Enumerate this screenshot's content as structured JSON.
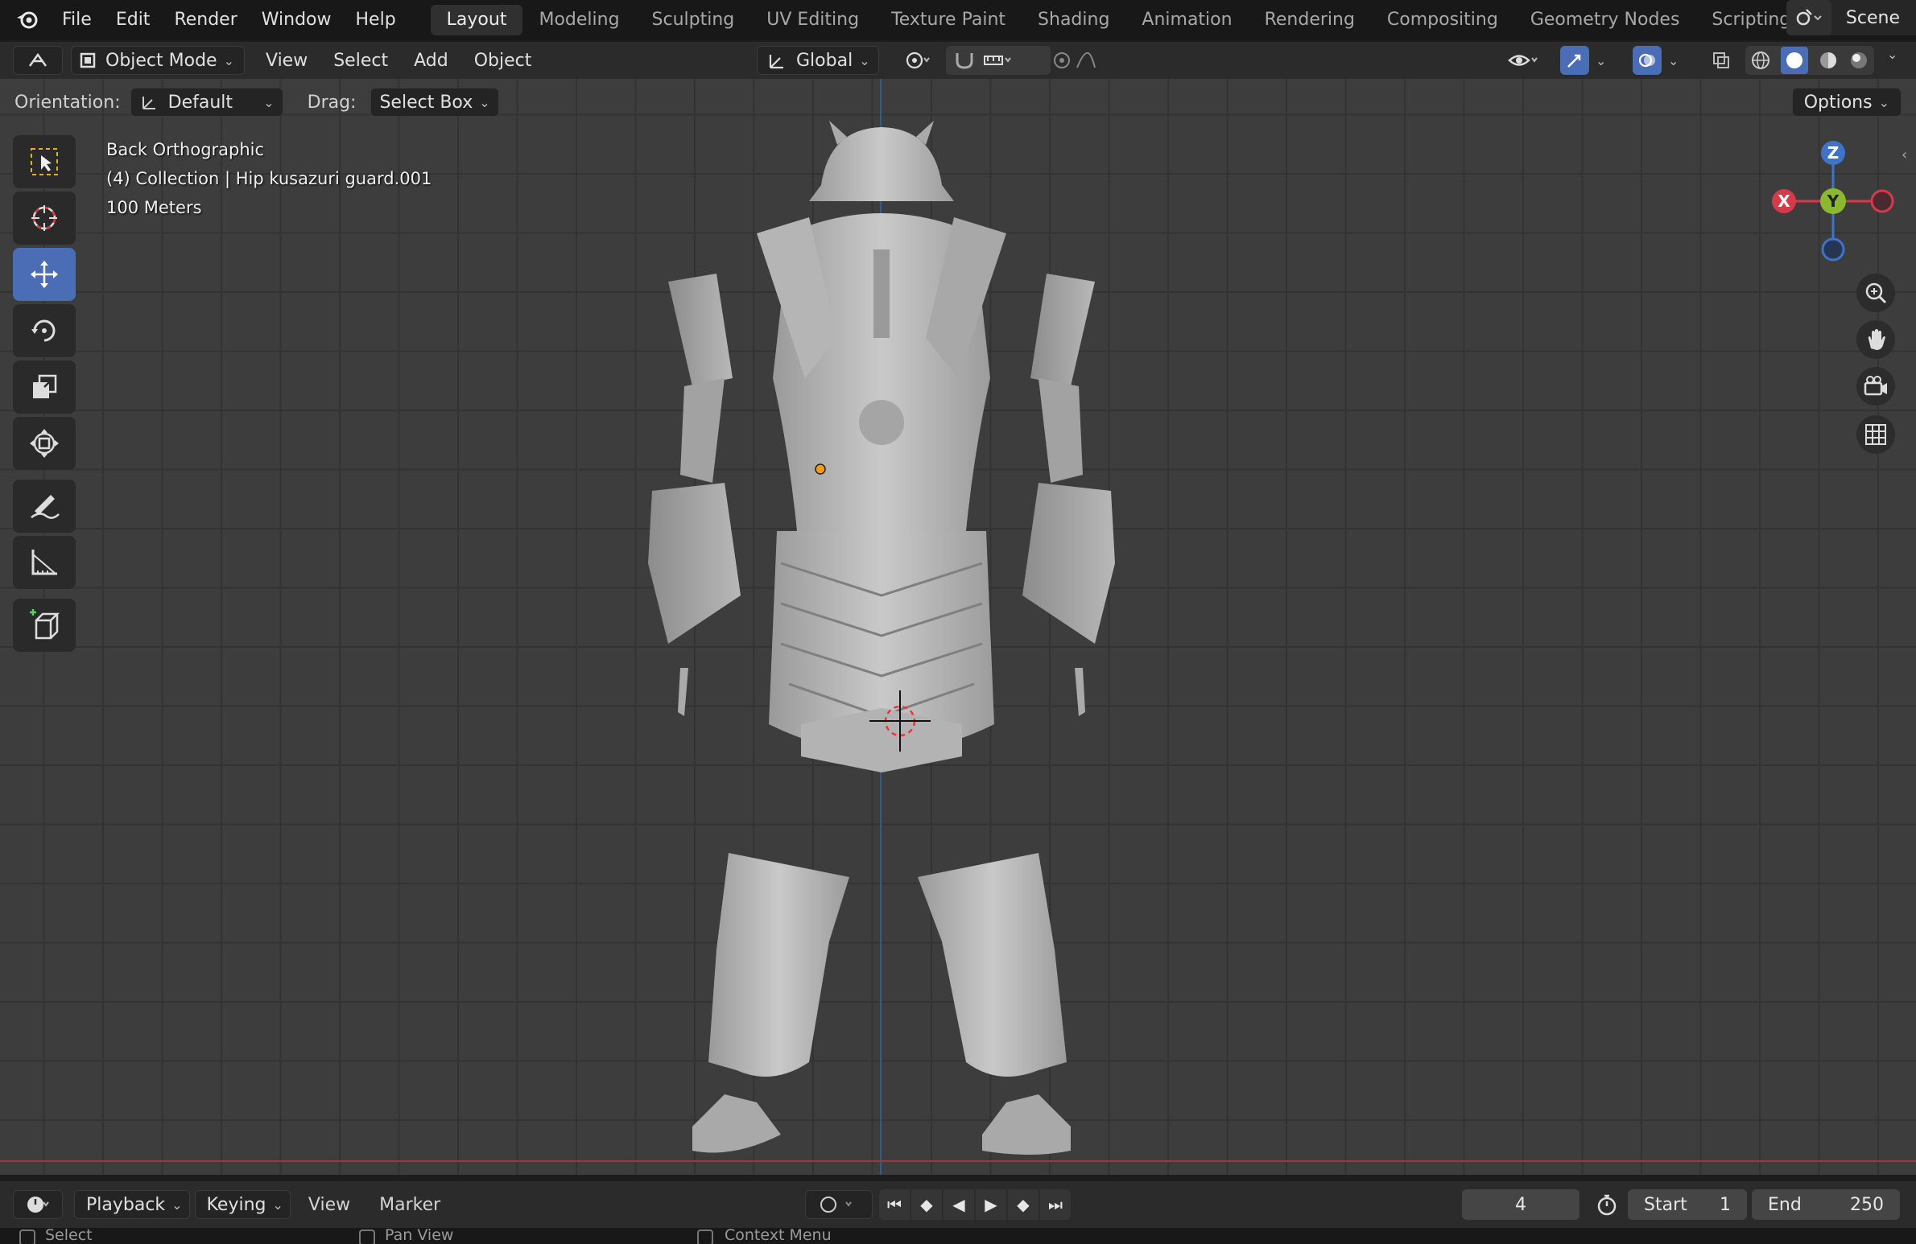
{
  "topbar": {
    "menu": [
      "File",
      "Edit",
      "Render",
      "Window",
      "Help"
    ],
    "tabs": [
      "Layout",
      "Modeling",
      "Sculpting",
      "UV Editing",
      "Texture Paint",
      "Shading",
      "Animation",
      "Rendering",
      "Compositing",
      "Geometry Nodes",
      "Scripting"
    ],
    "active_tab": "Layout",
    "add_tab": "+",
    "scene_name": "Scene"
  },
  "header": {
    "mode": "Object Mode",
    "menu": [
      "View",
      "Select",
      "Add",
      "Object"
    ],
    "transform_orientation": "Global"
  },
  "tool_settings": {
    "orientation_label": "Orientation:",
    "orientation_value": "Default",
    "drag_label": "Drag:",
    "drag_value": "Select Box",
    "options": "Options"
  },
  "viewport_info": {
    "view_name": "Back Orthographic",
    "collection": "(4) Collection | Hip kusazuri guard.001",
    "scale": "100 Meters"
  },
  "gizmo": {
    "x": "X",
    "y": "Y",
    "z": "Z"
  },
  "colors": {
    "accent": "#4a6db5",
    "axis_x": "#d6394a",
    "axis_y": "#8ab82e",
    "axis_z": "#3f72c9"
  },
  "timeline": {
    "menu": [
      "Playback",
      "Keying",
      "View",
      "Marker"
    ],
    "current_frame": "4",
    "start_label": "Start",
    "start_value": "1",
    "end_label": "End",
    "end_value": "250"
  },
  "statusbar": {
    "items": [
      "Select",
      "Pan View",
      "Context Menu"
    ]
  }
}
